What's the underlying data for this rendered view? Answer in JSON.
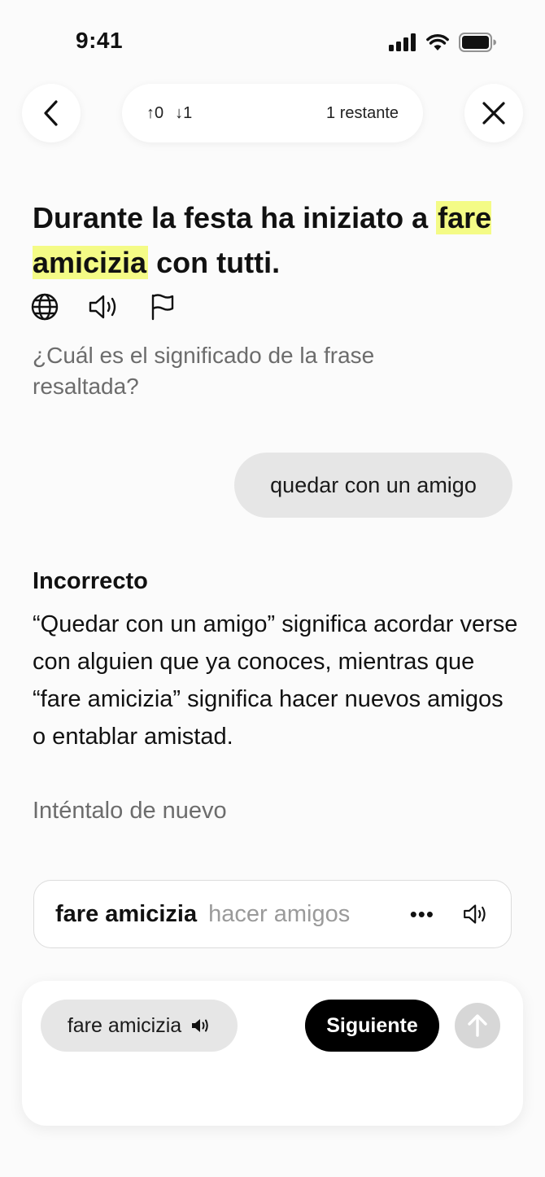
{
  "status_bar": {
    "time": "9:41"
  },
  "progress": {
    "up_count": "↑0",
    "down_count": "↓1",
    "remaining": "1 restante"
  },
  "exercise": {
    "sentence_before": "Durante la festa ha iniziato a",
    "sentence_highlight": "fare amicizia",
    "sentence_after": "con tutti.",
    "question": "¿Cuál es el significado de la frase resaltada?"
  },
  "answer": {
    "selected": "quedar con un amigo"
  },
  "feedback": {
    "title": "Incorrecto",
    "explanation": "“Quedar con un amigo” significa acordar verse con alguien que ya conoces, mientras que “fare amicizia” significa hacer nuevos amigos o entablar amistad.",
    "retry": "Inténtalo de nuevo"
  },
  "vocab": {
    "term": "fare amicizia",
    "translation": "hacer amigos",
    "more": "•••"
  },
  "bottom": {
    "chip_label": "fare amicizia",
    "next_label": "Siguiente"
  },
  "colors": {
    "highlight": "#f4fb86",
    "primary_button": "#000000",
    "bubble": "#e6e6e6"
  }
}
